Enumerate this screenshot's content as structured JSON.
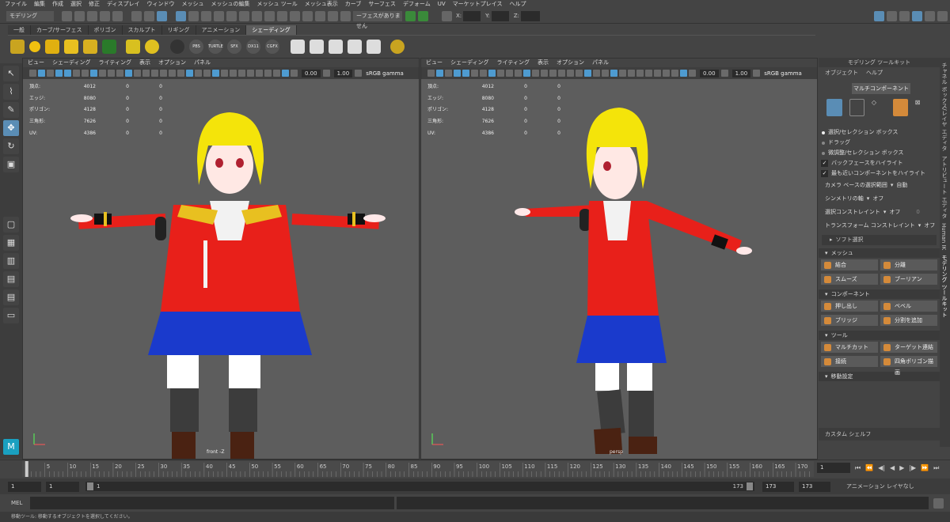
{
  "menu": [
    "ファイル",
    "編集",
    "作成",
    "選択",
    "修正",
    "ディスプレイ",
    "ウィンドウ",
    "メッシュ",
    "メッシュの編集",
    "メッシュ ツール",
    "メッシュ表示",
    "カーブ",
    "サーフェス",
    "デフォーム",
    "UV",
    "マーケットプレイス",
    "ヘルプ"
  ],
  "status": {
    "mode": "モデリング",
    "live_surface": "ーフェスがありません",
    "x_label": "X:",
    "y_label": "Y:",
    "z_label": "Z:"
  },
  "shelf_tabs": [
    "一般",
    "カーブ/サーフェス",
    "ポリゴン",
    "スカルプト",
    "リギング",
    "アニメーション",
    "シェーディング"
  ],
  "shelf_active": 6,
  "shelf_icons": [
    "PBS",
    "TURTLE",
    "SFX",
    "DX11",
    "CGFX"
  ],
  "viewport_menu": [
    "ビュー",
    "シェーディング",
    "ライティング",
    "表示",
    "オプション",
    "パネル"
  ],
  "viewport_values": {
    "exposure": "0.00",
    "gamma": "1.00",
    "color_space": "sRGB gamma"
  },
  "stats": [
    {
      "label": "頂点:",
      "v1": "4012",
      "v2": "0",
      "v3": "0"
    },
    {
      "label": "エッジ:",
      "v1": "8080",
      "v2": "0",
      "v3": "0"
    },
    {
      "label": "ポリゴン:",
      "v1": "4128",
      "v2": "0",
      "v3": "0"
    },
    {
      "label": "三角形:",
      "v1": "7626",
      "v2": "0",
      "v3": "0"
    },
    {
      "label": "UV:",
      "v1": "4386",
      "v2": "0",
      "v3": "0"
    }
  ],
  "left_camera": "front -Z",
  "right_camera": "persp",
  "panel": {
    "title": "モデリング ツールキット",
    "menu": [
      "オブジェクト",
      "ヘルプ"
    ],
    "multi": "マルチコンポーネント",
    "options": [
      {
        "label": "選択/セレクション ボックス",
        "on": true
      },
      {
        "label": "ドラッグ",
        "on": false
      },
      {
        "label": "微調整/セレクション ボックス",
        "on": false
      }
    ],
    "checks": [
      "バックフェースをハイライト",
      "最も近いコンポーネントをハイライト"
    ],
    "cam_select": "カメラ ベースの選択範囲",
    "cam_select_val": "自動",
    "symmetry": "シンメトリの軸",
    "symmetry_val": "オフ",
    "sel_constraint": "選択コンストレイント",
    "sel_constraint_val": "オフ",
    "sel_constraint_num": "0",
    "xf_constraint": "トランスフォーム コンストレイント",
    "xf_constraint_val": "オフ",
    "soft": "ソフト選択",
    "sections": [
      {
        "title": "メッシュ",
        "buttons": [
          "結合",
          "分離",
          "スムーズ",
          "ブーリアン"
        ]
      },
      {
        "title": "コンポーネント",
        "buttons": [
          "押し出し",
          "ベベル",
          "ブリッジ",
          "分割を追加"
        ]
      },
      {
        "title": "ツール",
        "buttons": [
          "マルチカット",
          "ターゲット連結",
          "接続",
          "四角ポリゴン描画"
        ]
      }
    ],
    "move_settings": "移動設定",
    "custom_shelf": "カスタム シェルフ"
  },
  "side_tabs": [
    "チャネル ボックス/レイヤ エディタ",
    "アトリビュート エディタ",
    "Human IK",
    "モデリング ツールキット"
  ],
  "timeline": {
    "ticks": [
      "5",
      "10",
      "15",
      "20",
      "25",
      "30",
      "35",
      "40",
      "45",
      "50",
      "55",
      "60",
      "65",
      "70",
      "75",
      "80",
      "85",
      "90",
      "95",
      "100",
      "105",
      "110",
      "115",
      "120",
      "125",
      "130",
      "135",
      "140",
      "145",
      "150",
      "155",
      "160",
      "165",
      "170"
    ],
    "current_frame": "1",
    "start": "1",
    "playback_start": "1",
    "range_start": "1",
    "range_end": "173",
    "playback_end": "173",
    "end": "173",
    "anim_layer": "アニメーション レイヤなし"
  },
  "mel_label": "MEL",
  "help_text": "移動ツール: 移動するオブジェクトを選択してください。",
  "colors": {
    "hair": "#f4e40a",
    "jacket": "#e8201a",
    "skirt": "#1a3acc",
    "boots": "#4a2212",
    "socks": "#3c3c3c"
  }
}
